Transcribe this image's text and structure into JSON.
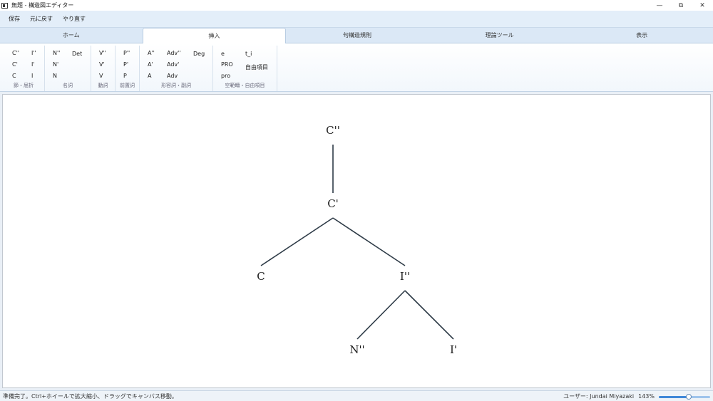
{
  "window": {
    "title": "無題 - 構造図エディター",
    "minimize_glyph": "—",
    "restore_glyph": "⧉",
    "close_glyph": "✕"
  },
  "menu": {
    "save": "保存",
    "undo": "元に戻す",
    "redo": "やり直す"
  },
  "tabs": [
    {
      "label": "ホーム",
      "active": false
    },
    {
      "label": "挿入",
      "active": true
    },
    {
      "label": "句構造規則",
      "active": false
    },
    {
      "label": "理論ツール",
      "active": false
    },
    {
      "label": "表示",
      "active": false
    }
  ],
  "ribbon": {
    "clause": {
      "label": "節・屈折",
      "items": [
        "C''",
        "I''",
        "C'",
        "I'",
        "C",
        "I"
      ]
    },
    "noun": {
      "label": "名詞",
      "items": [
        "N''",
        "Det",
        "N'",
        "N"
      ]
    },
    "verb": {
      "label": "動詞",
      "items": [
        "V''",
        "V'",
        "V"
      ]
    },
    "prep": {
      "label": "前置詞",
      "items": [
        "P''",
        "P'",
        "P"
      ]
    },
    "adj": {
      "label": "形容詞・副詞",
      "items": [
        "A''",
        "Adv''",
        "Deg",
        "A'",
        "Adv'",
        "A",
        "Adv"
      ]
    },
    "empty": {
      "label": "空範疇・自由項目",
      "items": [
        "e",
        "t_i",
        "PRO",
        "自由項目",
        "pro"
      ]
    }
  },
  "tree": {
    "nodes": [
      {
        "id": "c2",
        "label": "C''"
      },
      {
        "id": "c1",
        "label": "C'"
      },
      {
        "id": "c0",
        "label": "C"
      },
      {
        "id": "i2",
        "label": "I''"
      },
      {
        "id": "n2",
        "label": "N''"
      },
      {
        "id": "i1",
        "label": "I'"
      }
    ],
    "edges": [
      [
        "c2",
        "c1"
      ],
      [
        "c1",
        "c0"
      ],
      [
        "c1",
        "i2"
      ],
      [
        "i2",
        "n2"
      ],
      [
        "i2",
        "i1"
      ]
    ]
  },
  "status": {
    "message": "準備完了。Ctrl+ホイールで拡大縮小、ドラッグでキャンバス移動。",
    "user": "ユーザー: Jundai Miyazaki",
    "zoom": "143%",
    "zoom_fraction": 0.58
  },
  "colors": {
    "accent": "#3f88d8",
    "tree_line": "#2e3b47"
  }
}
